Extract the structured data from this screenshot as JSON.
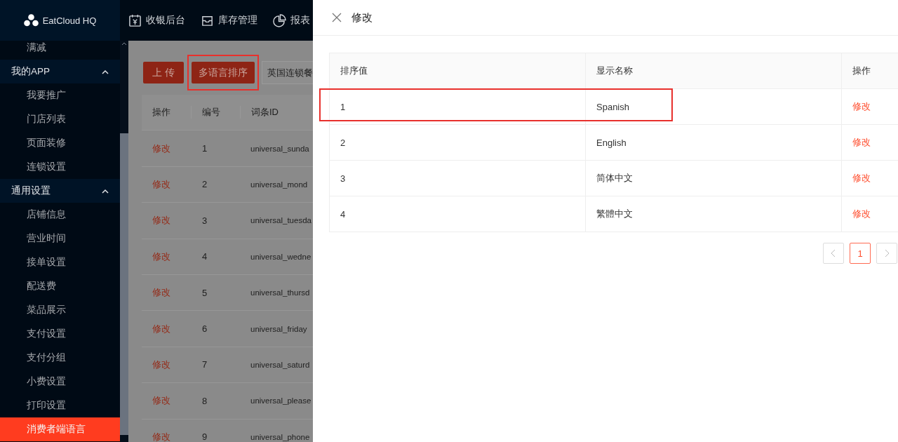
{
  "brand": {
    "name": "EatCloud HQ"
  },
  "top_nav": [
    {
      "label": "收银后台"
    },
    {
      "label": "库存管理"
    },
    {
      "label": "报表"
    }
  ],
  "sidebar": {
    "items": [
      {
        "kind": "item",
        "label": "满减",
        "selected": false
      },
      {
        "kind": "group",
        "label": "我的APP",
        "expanded": true
      },
      {
        "kind": "item",
        "label": "我要推广",
        "selected": false
      },
      {
        "kind": "item",
        "label": "门店列表",
        "selected": false
      },
      {
        "kind": "item",
        "label": "页面装修",
        "selected": false
      },
      {
        "kind": "item",
        "label": "连锁设置",
        "selected": false
      },
      {
        "kind": "group",
        "label": "通用设置",
        "expanded": true
      },
      {
        "kind": "item",
        "label": "店铺信息",
        "selected": false
      },
      {
        "kind": "item",
        "label": "营业时间",
        "selected": false
      },
      {
        "kind": "item",
        "label": "接单设置",
        "selected": false
      },
      {
        "kind": "item",
        "label": "配送费",
        "selected": false
      },
      {
        "kind": "item",
        "label": "菜品展示",
        "selected": false
      },
      {
        "kind": "item",
        "label": "支付设置",
        "selected": false
      },
      {
        "kind": "item",
        "label": "支付分组",
        "selected": false
      },
      {
        "kind": "item",
        "label": "小费设置",
        "selected": false
      },
      {
        "kind": "item",
        "label": "打印设置",
        "selected": false
      },
      {
        "kind": "item",
        "label": "消费者端语言",
        "selected": true
      }
    ]
  },
  "toolbar": {
    "buttons": [
      {
        "label": "上 传",
        "highlighted": false
      },
      {
        "label": "多语言排序",
        "highlighted": true
      }
    ],
    "store_select": {
      "value": "英国连锁餐"
    }
  },
  "table": {
    "columns": [
      "操作",
      "编号",
      "词条ID"
    ],
    "rows": [
      {
        "action": "修改",
        "no": "1",
        "id": "universal_sunda"
      },
      {
        "action": "修改",
        "no": "2",
        "id": "universal_mond"
      },
      {
        "action": "修改",
        "no": "3",
        "id": "universal_tuesda"
      },
      {
        "action": "修改",
        "no": "4",
        "id": "universal_wedne"
      },
      {
        "action": "修改",
        "no": "5",
        "id": "universal_thursd"
      },
      {
        "action": "修改",
        "no": "6",
        "id": "universal_friday"
      },
      {
        "action": "修改",
        "no": "7",
        "id": "universal_saturd"
      },
      {
        "action": "修改",
        "no": "8",
        "id": "universal_please"
      },
      {
        "action": "修改",
        "no": "9",
        "id": "universal_phone"
      }
    ]
  },
  "drawer": {
    "title": "修改",
    "table": {
      "columns": [
        "排序值",
        "显示名称",
        "操作"
      ],
      "rows": [
        {
          "sort": "1",
          "name": "Spanish",
          "action": "修改",
          "highlighted": true
        },
        {
          "sort": "2",
          "name": "English",
          "action": "修改",
          "highlighted": false
        },
        {
          "sort": "3",
          "name": "简体中文",
          "action": "修改",
          "highlighted": false
        },
        {
          "sort": "4",
          "name": "繁體中文",
          "action": "修改",
          "highlighted": false
        }
      ]
    },
    "pagination": {
      "pages": [
        {
          "label": "1",
          "selected": true
        }
      ]
    }
  }
}
